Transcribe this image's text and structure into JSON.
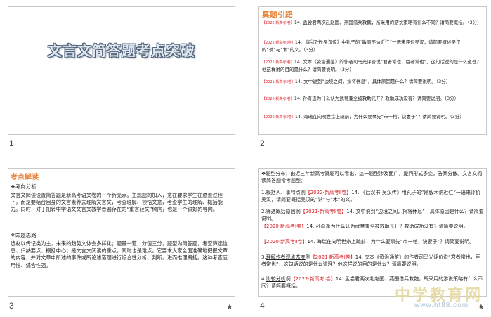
{
  "slides": [
    {
      "number": "1",
      "title": "文言文简答题考点突破"
    },
    {
      "number": "2",
      "heading": "真题引路",
      "questions": [
        {
          "tag": "【2022·新高考Ⅰ卷】",
          "text": "14. 孟尝君两次赴赵国、燕国借兵救魏，所采用的游说策略有什么不同？请简要概括。（3分）"
        },
        {
          "tag": "【2022·新高考Ⅱ卷】",
          "text": "14. 《后汉书·吴汉传》中孔子的“敏而不讷近仁”一语来评价吴汉，请简要概述吴汉的“讷”与“木”的义。（3分）"
        },
        {
          "tag": "【2021·新高考Ⅰ卷】",
          "text": "14. 文本《资治通鉴》的作者司马光评价说“君者常也，臣者常也”，这句话说的是什么道理？他这样说的目的是什么？请简要说明。（3分）"
        },
        {
          "tag": "【2021·新高考Ⅱ卷】",
          "text": "14. 文中说到“边境之间，捐将休息”，具体原因是什么？请简要说明。（3分）"
        },
        {
          "tag": "【2020·新高考Ⅰ卷】",
          "text": "14. 孙奇逢为什么认为武帝兼全被救助光开？救助成功没有？请简要说明。（3分）"
        },
        {
          "tag": "【2020·新高考Ⅱ卷】",
          "text": "14. 海瑞在向明世宗上疏前，为什么要事先“市一棺，诀妻子”？请简要说明。（3分）"
        }
      ]
    },
    {
      "number": "3",
      "heading": "考点解读",
      "sub1": "❖考向分析",
      "para1": "文言文阅读设置简答题是新高考语文卷的一个新亮点。主观题的加入，意在要求学生在悬置过程下，而是要结合自身的文言素养去理解文言文，考查理解、领悟文意，考查学生的理解、概括能力。同时，对于扭转中学语文文言文教学普遍存在的“重言轻文”倾向，也是一个很好的导向。",
      "sub2": "❖命题思路",
      "para2": "选材以传记类为主，未来的趋势文体会多样化；题量一道，分值三分，题型为简答题，考查筛选信息、归纳要点、概括中心；是文言文阅读的重点，同时也是难点。它要求大家全面准确地把握文章的内容，并对文章中所述的事件或所论述道理进行综合性分析、判断，进而推理概括。这种考查应用性、综合性强。",
      "star": "★"
    },
    {
      "number": "4",
      "intro": "❖题型分布：由近三年新高考真题可以看出，这一题型涉及面广，提问形式多变，答案分散。文言文阅读简答题常考题型：",
      "items": [
        {
          "prefix": "1.",
          "label": "概括人、事特点",
          "ex": "例",
          "tag": "【2022·新高考Ⅱ卷】",
          "text": "14. 《后汉书·吴汉传》用孔子的“刚毅木讷近仁”一语来评价吴汉，请简要概括吴汉的“讷”与“木”的义。"
        },
        {
          "prefix": "2.",
          "label": "筛选概括原因",
          "ex": "例",
          "tag": "【2021·新高考Ⅱ卷】",
          "text": "14. 文中说到“边境之间，捐将休息”，具体原因是什么？请简要说明。"
        },
        {
          "prefix": "",
          "label": "",
          "ex": "",
          "tag": "【2020·新高考Ⅰ卷】",
          "text": "14. 孙奇逢为什么认为武帝兼全被救助光开？救助成功没有？请简要说明。"
        },
        {
          "prefix": "",
          "label": "",
          "ex": "",
          "tag": "【2020·新高考Ⅱ卷】",
          "text": "14. 海瑞在向明世宗上疏前，为什么要事先“市一棺，诀妻子”？请简要说明。"
        },
        {
          "prefix": "3.",
          "label": "理解作者观点态度",
          "ex": "例",
          "tag": "【2021·新高考Ⅰ卷】",
          "text": "14. 文本《资治通鉴》的作者司马光评价说“君者常也，臣者常也”，这句话说的是什么道理？他这样说的目的是什么？请简要说明。"
        },
        {
          "prefix": "4.",
          "label": "比较分析",
          "ex": "例",
          "tag": "【2022·新高考Ⅰ卷】",
          "text": "14. 孟尝君两次赴赵国、燕国借兵救魏，所采用的游说策略有什么不同？请简要概括。"
        }
      ],
      "star": "★"
    }
  ],
  "watermark": {
    "text": "中学教育网",
    "url": "www.ht88.com"
  }
}
